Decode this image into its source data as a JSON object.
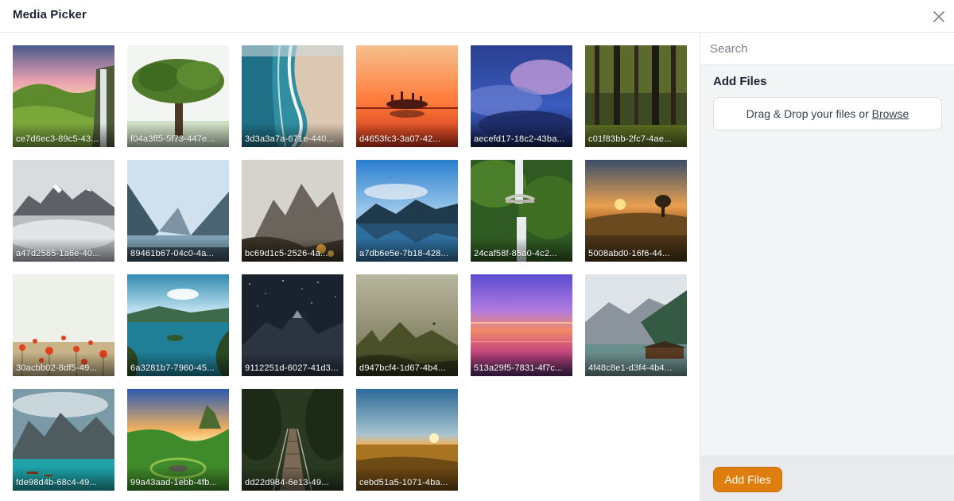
{
  "header": {
    "title": "Media Picker",
    "close_icon": "close-icon"
  },
  "search": {
    "placeholder": "Search",
    "value": ""
  },
  "upload": {
    "heading": "Add Files",
    "dropzone_text": "Drag & Drop your files or ",
    "browse_label": "Browse"
  },
  "footer": {
    "add_button_label": "Add Files"
  },
  "colors": {
    "accent": "#dd7e0f",
    "panel_bg": "#f3f4f6",
    "border": "#e3e6ea"
  },
  "media": [
    {
      "name": "ce7d6ec3-89c5-43...",
      "scene": "waterfall-hills-sunset"
    },
    {
      "name": "f04a3ff5-5f73-447e...",
      "scene": "big-tree"
    },
    {
      "name": "3d3a3a7a-671e-440...",
      "scene": "beach-waves-aerial"
    },
    {
      "name": "d4653fc3-3a07-42...",
      "scene": "orange-sunset-island"
    },
    {
      "name": "aecefd17-18c2-43ba...",
      "scene": "stormy-purple-clouds"
    },
    {
      "name": "c01f83bb-2fc7-4ae...",
      "scene": "forest"
    },
    {
      "name": "a47d2585-1a6e-40...",
      "scene": "misty-snowy-mountains"
    },
    {
      "name": "89461b67-04c0-4a...",
      "scene": "mountain-valley-lake"
    },
    {
      "name": "bc69d1c5-2526-4a...",
      "scene": "rocky-peaks-haze"
    },
    {
      "name": "a7db6e5e-7b18-428...",
      "scene": "mountain-lake-reflection"
    },
    {
      "name": "24caf58f-85a0-4c2...",
      "scene": "waterfall-bridge"
    },
    {
      "name": "5008abd0-16f6-44...",
      "scene": "sunset-field-tree"
    },
    {
      "name": "30acbb02-8df5-49...",
      "scene": "poppy-flowers"
    },
    {
      "name": "6a3281b7-7960-45...",
      "scene": "lake-islands"
    },
    {
      "name": "9112251d-6027-41d3...",
      "scene": "night-mountains-stars"
    },
    {
      "name": "d947bcf4-1d67-4b4...",
      "scene": "foggy-cliffs"
    },
    {
      "name": "513a29f5-7831-4f7c...",
      "scene": "purple-sunset-sea"
    },
    {
      "name": "4f48c8e1-d3f4-4b4...",
      "scene": "alpine-lake-cabin"
    },
    {
      "name": "fde98d4b-68c4-49...",
      "scene": "turquoise-mountain-lake"
    },
    {
      "name": "99a43aad-1ebb-4fb...",
      "scene": "green-valley-sunrise"
    },
    {
      "name": "dd22d984-6e13-49...",
      "scene": "jungle-bridge"
    },
    {
      "name": "cebd51a5-1071-4ba...",
      "scene": "golden-field-sunrise"
    }
  ]
}
